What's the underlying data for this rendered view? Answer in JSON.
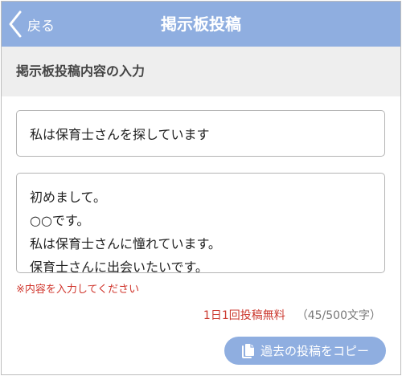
{
  "nav": {
    "back_label": "戻る",
    "title": "掲示板投稿"
  },
  "section": {
    "title": "掲示板投稿内容の入力"
  },
  "form": {
    "title_value": "私は保育士さんを探しています",
    "body_lines": [
      "初めまして。",
      "○○です。",
      "私は保育士さんに憧れています。",
      "保育士さんに出会いたいです。"
    ],
    "validation_message": "※内容を入力してください"
  },
  "post_info": {
    "free_label": "1日1回投稿無料",
    "char_count": "（45/500文字）"
  },
  "copy_button": {
    "label": "過去の投稿をコピー",
    "icon": "copy-icon"
  },
  "colors": {
    "accent": "#8faee0",
    "error": "#d0352c",
    "section_bg": "#eeeeee"
  }
}
